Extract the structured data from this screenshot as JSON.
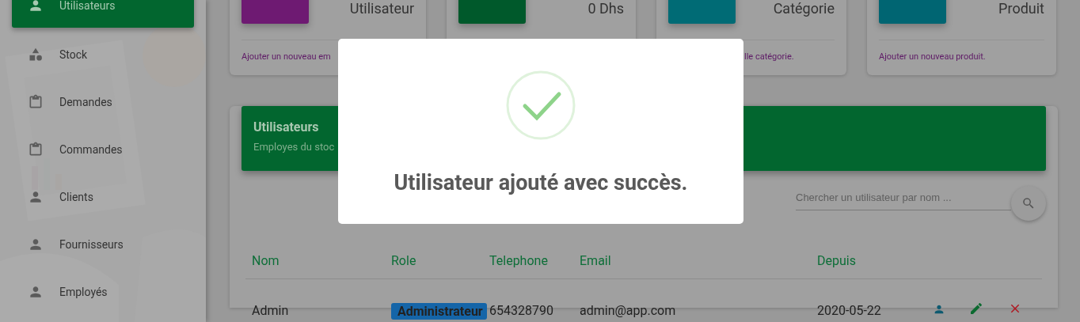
{
  "sidebar": {
    "items": [
      {
        "label": "Utilisateurs",
        "kind": "person",
        "selected": true
      },
      {
        "label": "Stock",
        "kind": "shapes",
        "selected": false
      },
      {
        "label": "Demandes",
        "kind": "clipboard",
        "selected": false
      },
      {
        "label": "Commandes",
        "kind": "clipboard",
        "selected": false
      },
      {
        "label": "Clients",
        "kind": "person",
        "selected": false
      },
      {
        "label": "Fournisseurs",
        "kind": "person",
        "selected": false
      },
      {
        "label": "Employés",
        "kind": "person",
        "selected": false
      }
    ]
  },
  "stat_cards": [
    {
      "label": "Utilisateur",
      "color": "#6e1a72",
      "link": "Ajouter un nouveau em"
    },
    {
      "label": "0 Dhs",
      "color": "#00592b"
    },
    {
      "label": "Catégorie",
      "color": "#006b75",
      "link": "lle catégorie."
    },
    {
      "label": "Produit",
      "color": "#006572",
      "link": "Ajouter un nouveau produit."
    }
  ],
  "panel": {
    "title": "Utilisateurs",
    "subtitle": "Employes du stoc",
    "search": {
      "placeholder": "Chercher un utilisateur par nom ..."
    },
    "table": {
      "columns": [
        "Nom",
        "Role",
        "Telephone",
        "Email",
        "Depuis"
      ],
      "rows": [
        {
          "name": "Admin",
          "role": "Administrateur",
          "telephone": "654328790",
          "email": "admin@app.com",
          "since": "2020-05-22"
        }
      ]
    }
  },
  "modal": {
    "message": "Utilisateur ajouté avec succès."
  }
}
